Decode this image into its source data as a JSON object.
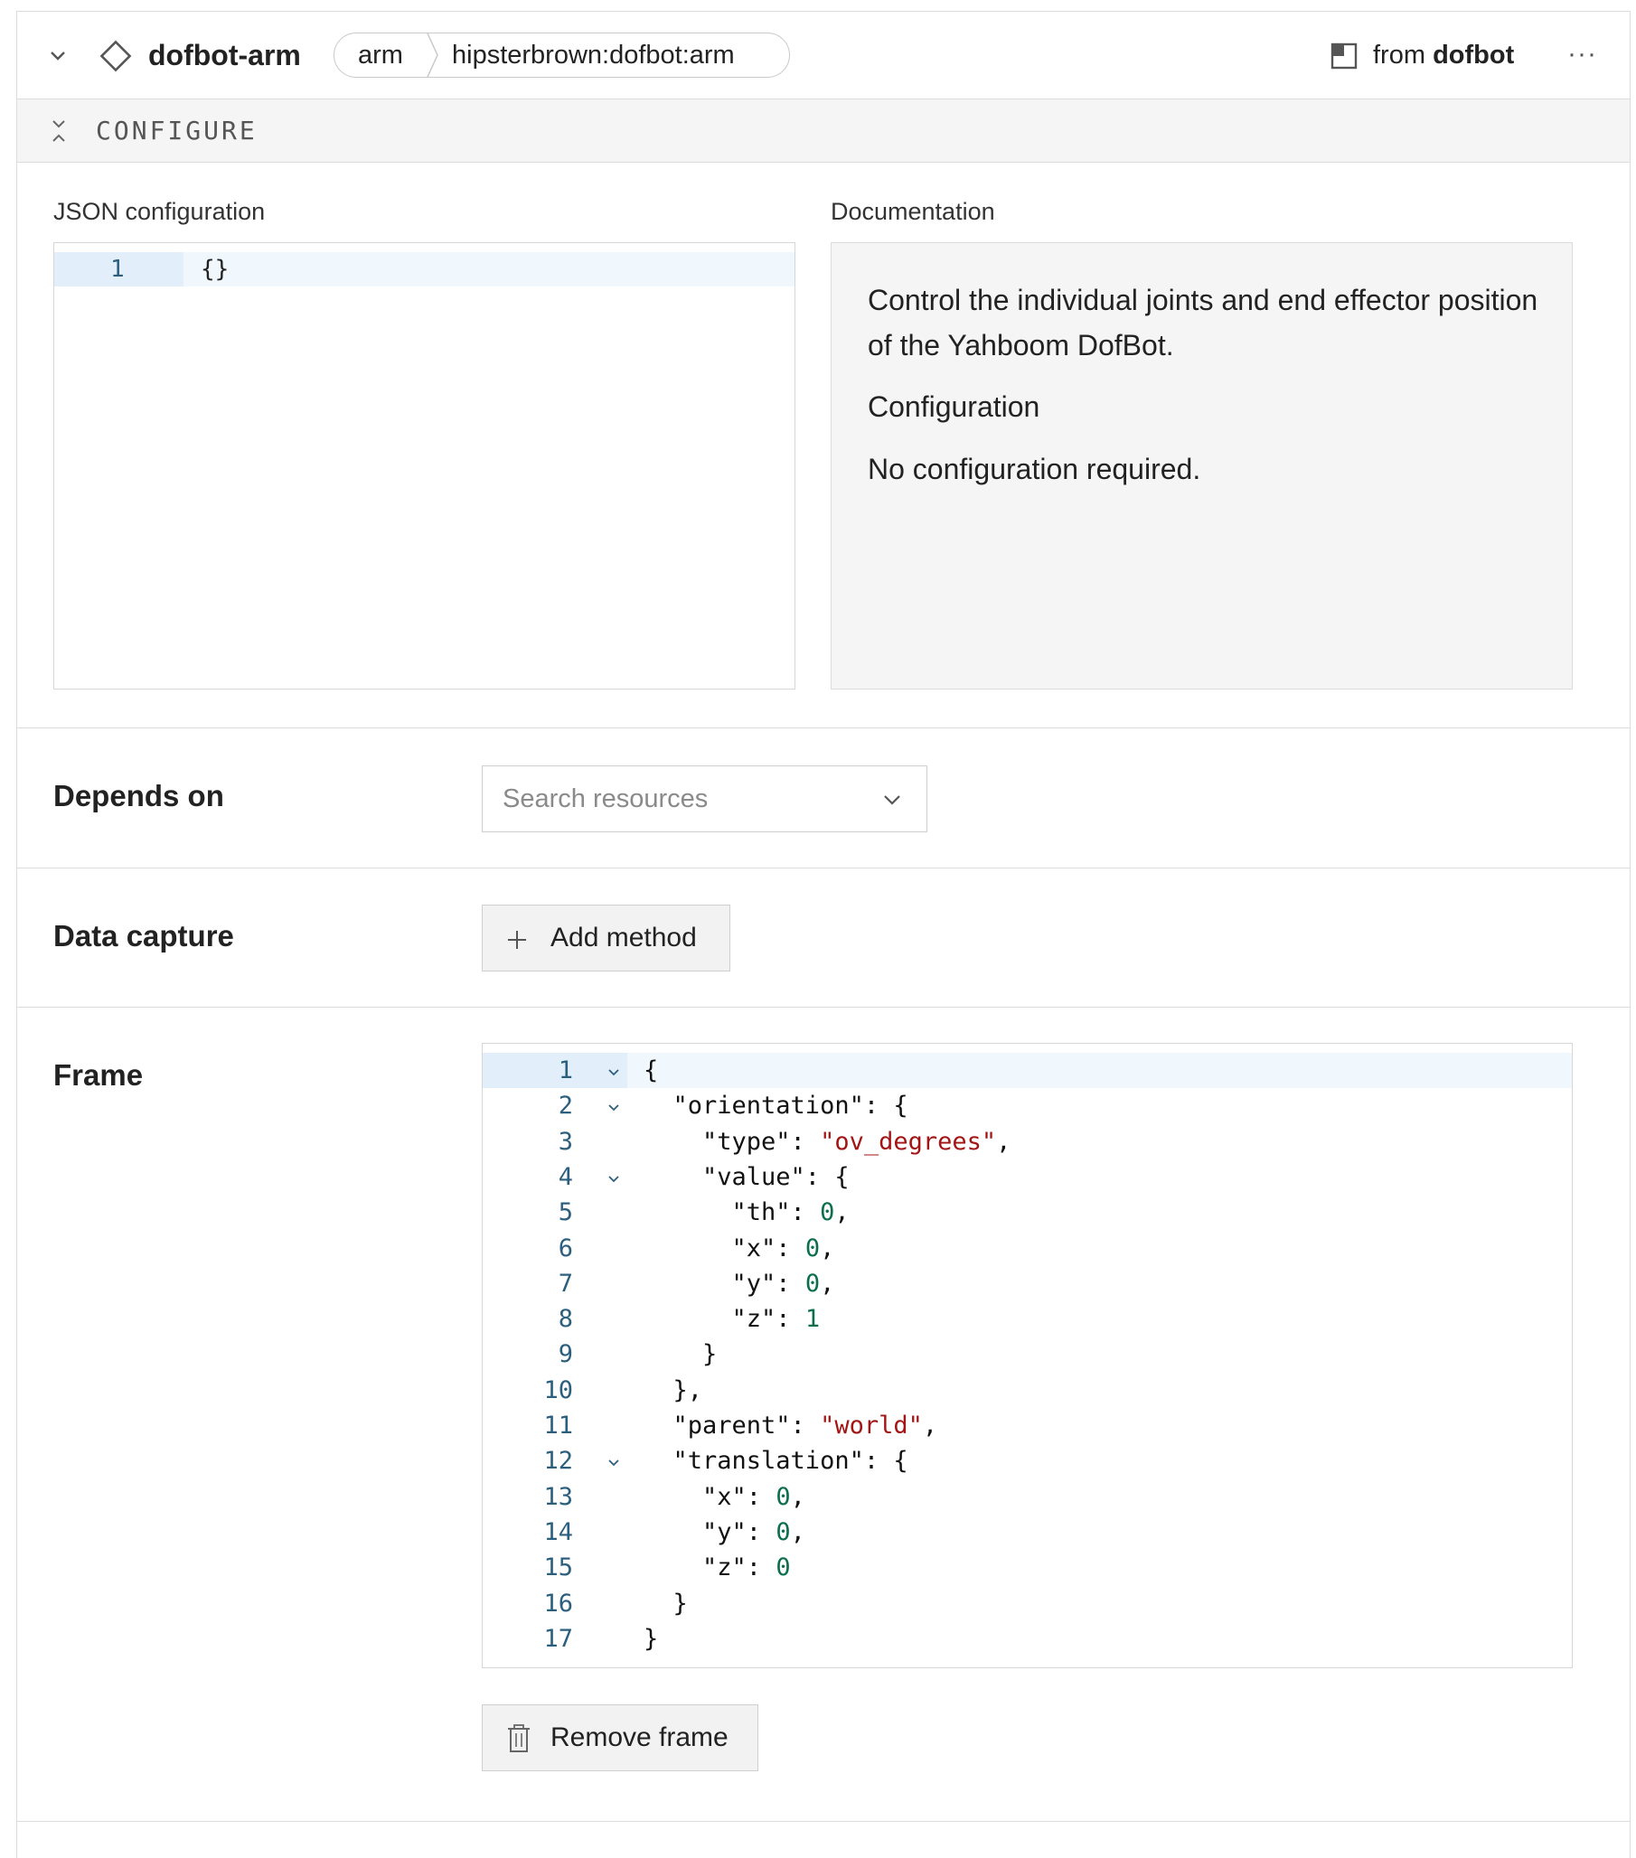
{
  "header": {
    "name": "dofbot-arm",
    "tag_type": "arm",
    "tag_model": "hipsterbrown:dofbot:arm",
    "from_prefix": "from",
    "from_module": "dofbot",
    "more": "···"
  },
  "configure": {
    "label": "CONFIGURE"
  },
  "json_config": {
    "label": "JSON configuration",
    "line_number": "1",
    "code": "{}"
  },
  "documentation": {
    "label": "Documentation",
    "paragraphs": [
      "Control the individual joints and end effector position of the Yahboom DofBot.",
      "Configuration",
      "No configuration required."
    ]
  },
  "depends_on": {
    "label": "Depends on",
    "placeholder": "Search resources"
  },
  "data_capture": {
    "label": "Data capture",
    "button": "Add method"
  },
  "frame": {
    "label": "Frame",
    "remove_button": "Remove frame",
    "lines": [
      {
        "n": "1",
        "fold": true
      },
      {
        "n": "2",
        "fold": true
      },
      {
        "n": "3",
        "fold": false
      },
      {
        "n": "4",
        "fold": true
      },
      {
        "n": "5",
        "fold": false
      },
      {
        "n": "6",
        "fold": false
      },
      {
        "n": "7",
        "fold": false
      },
      {
        "n": "8",
        "fold": false
      },
      {
        "n": "9",
        "fold": false
      },
      {
        "n": "10",
        "fold": false
      },
      {
        "n": "11",
        "fold": false
      },
      {
        "n": "12",
        "fold": true
      },
      {
        "n": "13",
        "fold": false
      },
      {
        "n": "14",
        "fold": false
      },
      {
        "n": "15",
        "fold": false
      },
      {
        "n": "16",
        "fold": false
      },
      {
        "n": "17",
        "fold": false
      }
    ],
    "code": [
      "{",
      "  \"orientation\": {",
      "    \"type\": \"ov_degrees\",",
      "    \"value\": {",
      "      \"th\": 0,",
      "      \"x\": 0,",
      "      \"y\": 0,",
      "      \"z\": 1",
      "    }",
      "  },",
      "  \"parent\": \"world\",",
      "  \"translation\": {",
      "    \"x\": 0,",
      "    \"y\": 0,",
      "    \"z\": 0",
      "  }",
      "}"
    ]
  },
  "colors": {
    "border": "#dcdcdc",
    "panel_bg": "#f5f5f5",
    "line_number": "#2c5f7e",
    "string": "#a31515",
    "number": "#0b6e4f",
    "active_line": "#f0f7fd"
  }
}
